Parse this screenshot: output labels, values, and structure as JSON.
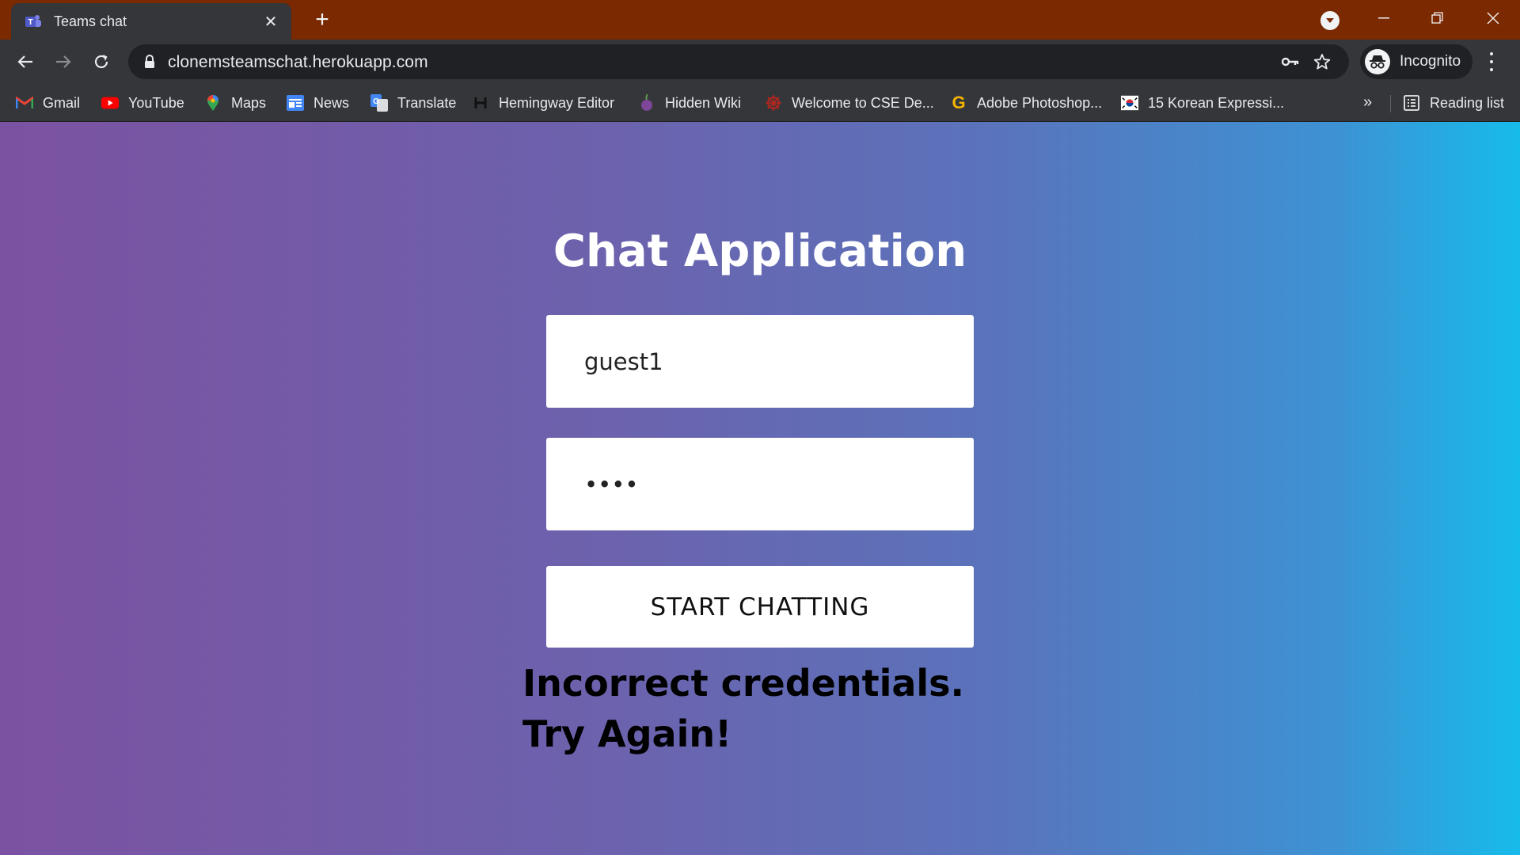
{
  "browser": {
    "tab_title": "Teams chat",
    "url": "clonemsteamschat.herokuapp.com",
    "profile_label": "Incognito",
    "frame_color": "#7a2900",
    "bookmarks": [
      {
        "label": "Gmail",
        "icon": "gmail-icon"
      },
      {
        "label": "YouTube",
        "icon": "youtube-icon"
      },
      {
        "label": "Maps",
        "icon": "maps-icon"
      },
      {
        "label": "News",
        "icon": "news-icon"
      },
      {
        "label": "Translate",
        "icon": "translate-icon"
      },
      {
        "label": "Hemingway Editor",
        "icon": "hemingway-icon"
      },
      {
        "label": "Hidden Wiki",
        "icon": "hidden-wiki-icon"
      },
      {
        "label": "Welcome to CSE De...",
        "icon": "cse-icon"
      },
      {
        "label": "Adobe Photoshop...",
        "icon": "photoshop-icon"
      },
      {
        "label": "15 Korean Expressi...",
        "icon": "korean-flag-icon"
      }
    ],
    "more_label": "»",
    "reading_list_label": "Reading list"
  },
  "page": {
    "title": "Chat Application",
    "username_value": "guest1",
    "password_value": "1234",
    "submit_label": "START CHATTING",
    "error_message": "Incorrect credentials. Try Again!",
    "gradient_start": "#7b52a1",
    "gradient_end": "#17bbea"
  }
}
